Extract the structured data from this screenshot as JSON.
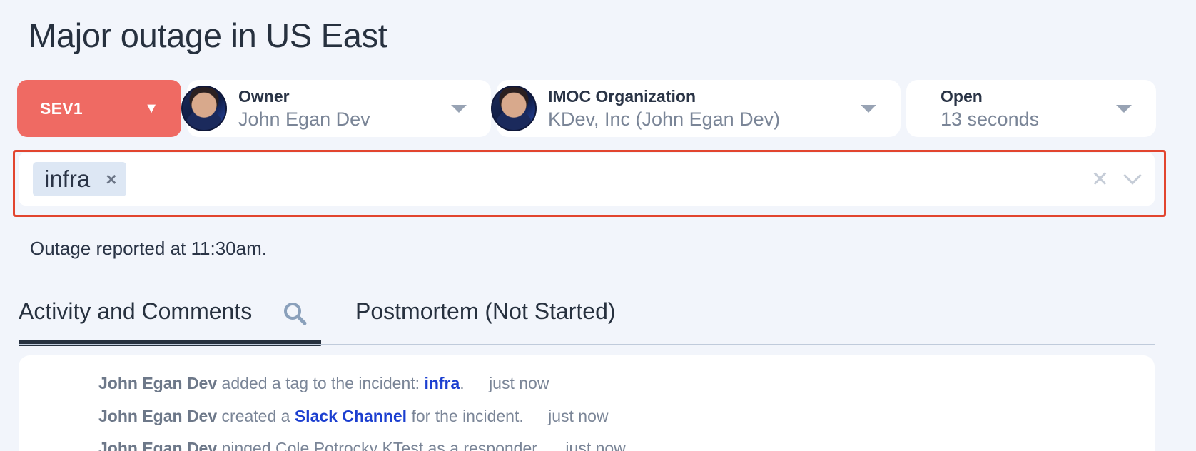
{
  "page_title": "Major outage in US East",
  "severity": {
    "label": "SEV1",
    "caret": "▼",
    "color": "#ef6a63"
  },
  "owner": {
    "label": "Owner",
    "value": "John Egan Dev"
  },
  "imoc": {
    "label": "IMOC Organization",
    "value": "KDev, Inc (John Egan Dev)"
  },
  "status": {
    "label": "Open",
    "value": "13 seconds"
  },
  "tags": {
    "items": [
      {
        "label": "infra",
        "remove": "×"
      }
    ],
    "clear": "✕",
    "outline_color": "#e2452f"
  },
  "description": "Outage reported at 11:30am.",
  "tabs": [
    {
      "label": "Activity and Comments",
      "active": true
    },
    {
      "label": "Postmortem (Not Started)",
      "active": false
    }
  ],
  "activity": [
    {
      "actor": "John Egan Dev",
      "pre": "added a tag to the incident:",
      "link": "infra",
      "post": ".",
      "time": "just now"
    },
    {
      "actor": "John Egan Dev",
      "pre": "created a",
      "link": "Slack Channel",
      "post": "for the incident.",
      "time": "just now"
    },
    {
      "actor": "John Egan Dev",
      "pre": "pinged Cole Potrocky KTest as a responder.",
      "link": "",
      "post": "",
      "time": "just now"
    }
  ],
  "icons": {
    "search": "search-icon",
    "dropdown": "chevron-down-icon",
    "remove": "close-icon"
  }
}
